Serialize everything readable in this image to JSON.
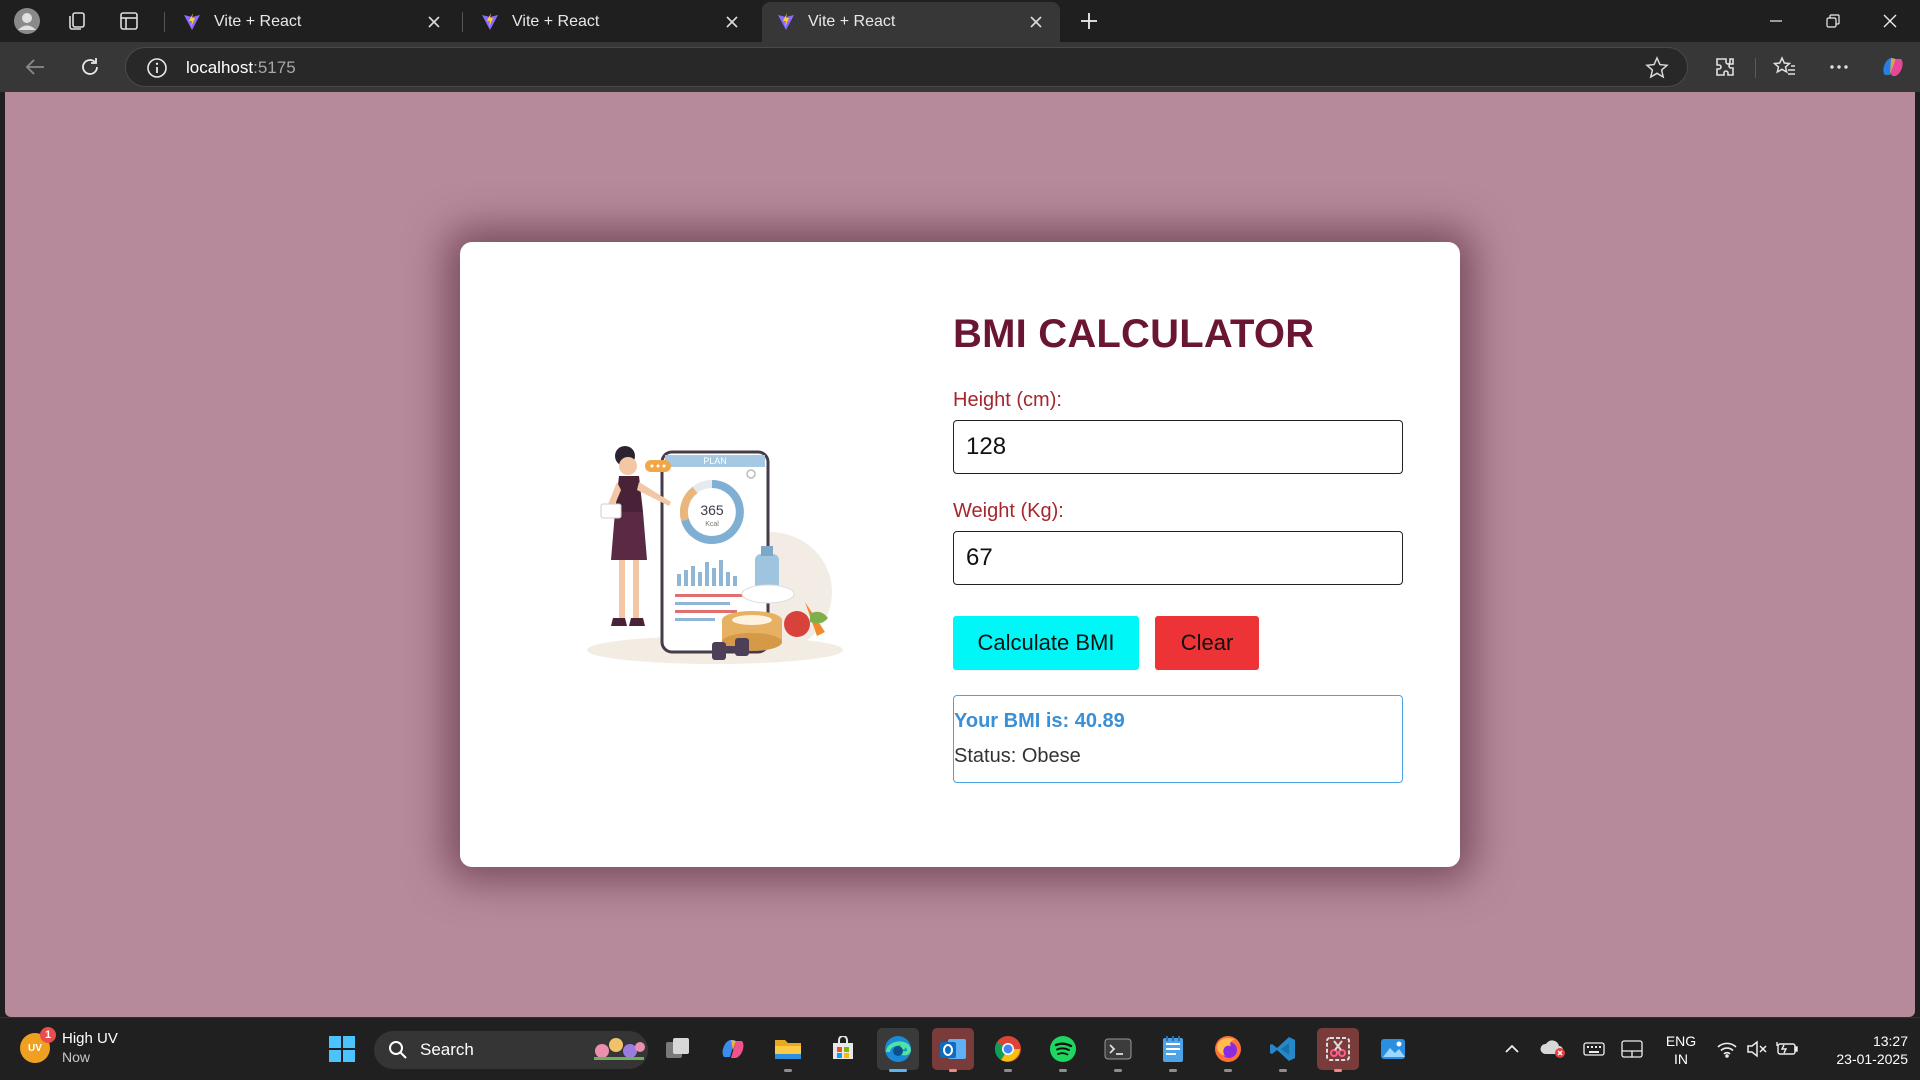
{
  "browser": {
    "tabs": [
      {
        "title": "Vite + React",
        "active": false
      },
      {
        "title": "Vite + React",
        "active": false
      },
      {
        "title": "Vite + React",
        "active": true
      }
    ],
    "address": {
      "host": "localhost",
      "port": ":5175"
    }
  },
  "app": {
    "title": "BMI CALCULATOR",
    "height_label": "Height (cm):",
    "height_value": "128",
    "weight_label": "Weight (Kg):",
    "weight_value": "67",
    "calculate_label": "Calculate BMI",
    "clear_label": "Clear",
    "result_bmi": "Your BMI is: 40.89",
    "result_status": "Status: Obese",
    "illustration_texts": {
      "plan": "PLAN",
      "kcal_value": "365",
      "kcal_unit": "Kcal"
    },
    "colors": {
      "background": "#b78a9b",
      "heading": "#6a1533",
      "label": "#a6262e",
      "calculate": "#00f7f7",
      "clear": "#ee3336",
      "result_border": "#4aa3e4"
    }
  },
  "taskbar": {
    "weather": {
      "badge": "1",
      "icon_text": "UV",
      "title": "High UV",
      "subtitle": "Now"
    },
    "search_label": "Search",
    "apps": [
      "task-view",
      "copilot",
      "file-explorer",
      "microsoft-store",
      "edge",
      "outlook",
      "chrome",
      "spotify",
      "terminal",
      "notepad",
      "firefox",
      "vscode",
      "snipping-tool",
      "photos"
    ],
    "language": {
      "line1": "ENG",
      "line2": "IN"
    },
    "clock": {
      "time": "13:27",
      "date": "23-01-2025"
    }
  }
}
